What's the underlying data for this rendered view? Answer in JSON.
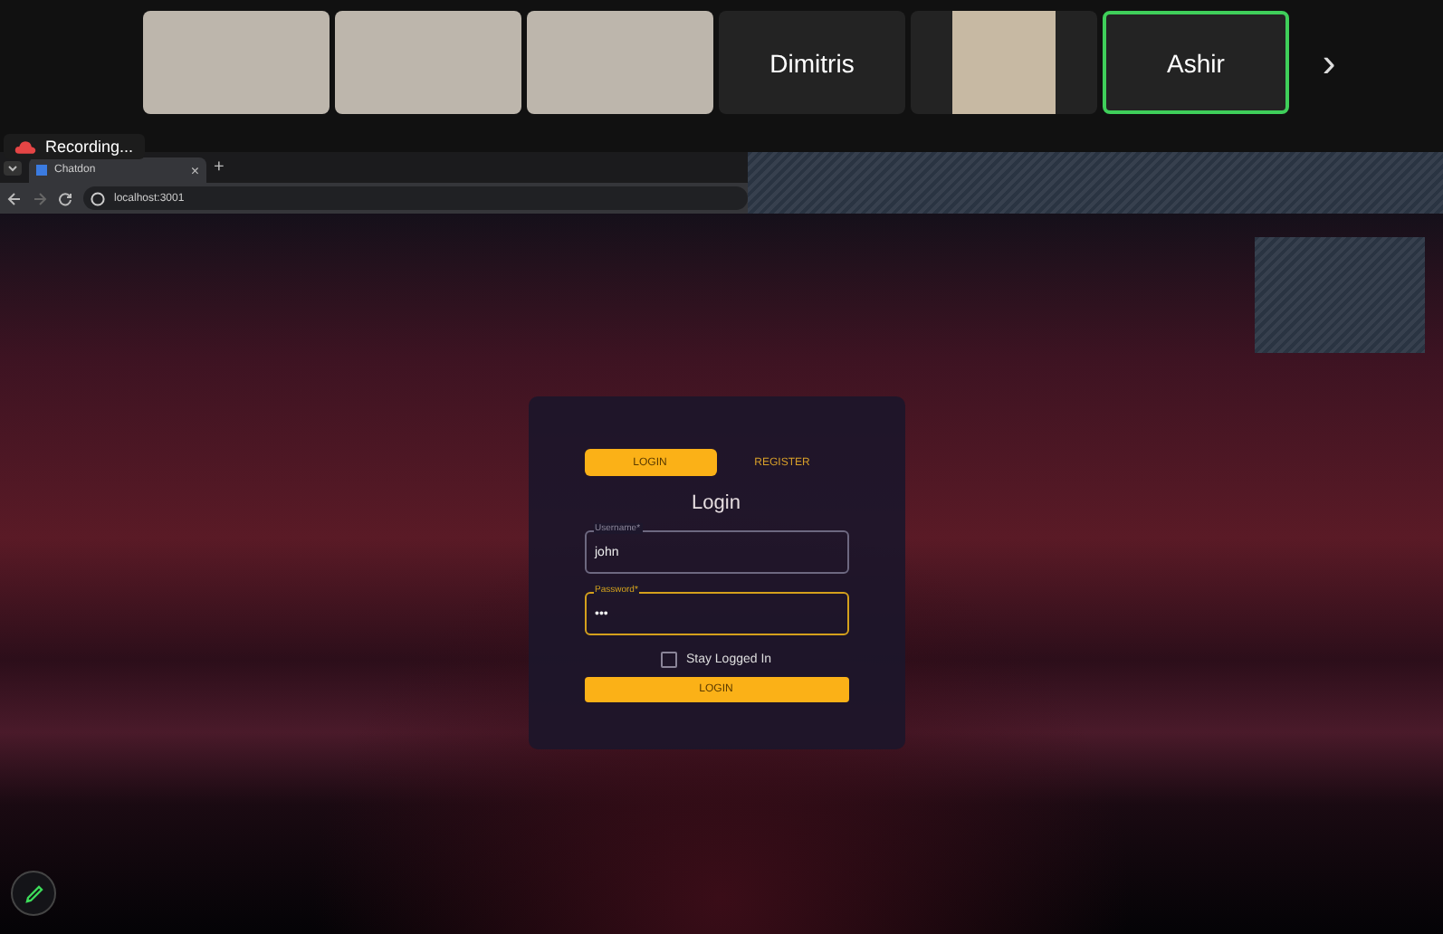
{
  "meeting": {
    "participants": [
      {
        "kind": "video",
        "speaking": false
      },
      {
        "kind": "video",
        "speaking": false
      },
      {
        "kind": "video",
        "speaking": false
      },
      {
        "kind": "name",
        "name": "Dimitris",
        "speaking": false
      },
      {
        "kind": "avatar",
        "speaking": false
      },
      {
        "kind": "name",
        "name": "Ashir",
        "speaking": true
      }
    ],
    "next_button": "›",
    "recording_badge": "Recording..."
  },
  "browser": {
    "tabs": [
      {
        "title": "Chatdon",
        "selected": true
      }
    ],
    "new_tab": "+",
    "close_tab": "×",
    "address": "localhost:3001"
  },
  "login_card": {
    "tabs": [
      {
        "label": "LOGIN",
        "selected": true
      },
      {
        "label": "REGISTER",
        "selected": false
      }
    ],
    "heading": "Login",
    "fields": [
      {
        "label": "Username*",
        "value": "john",
        "focused": false
      },
      {
        "label": "Password*",
        "value": "•••",
        "focused": true
      }
    ],
    "stay_logged_in": {
      "label": "Stay Logged In",
      "checked": false
    },
    "submit": "LOGIN"
  }
}
